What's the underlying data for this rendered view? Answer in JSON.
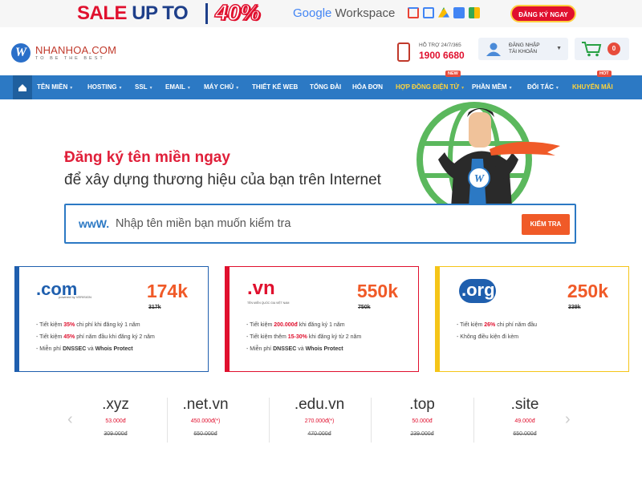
{
  "promo": {
    "sale": "SALE",
    "up_to": "UP TO",
    "percent": "40%",
    "google": "Google",
    "workspace": "Workspace",
    "cta": "ĐĂNG KÝ NGAY"
  },
  "header": {
    "logo_name": "NHANHOA.COM",
    "logo_tagline": "TO BE THE BEST",
    "support_label": "HỖ TRỢ 24/7/365",
    "support_phone": "1900 6680",
    "login_line1": "ĐĂNG NHẬP",
    "login_line2": "TÀI KHOẢN",
    "cart_count": "0"
  },
  "nav": {
    "items": [
      {
        "label": "TÊN MIỀN"
      },
      {
        "label": "HOSTING"
      },
      {
        "label": "SSL"
      },
      {
        "label": "EMAIL"
      },
      {
        "label": "MÁY CHỦ"
      },
      {
        "label": "THIẾT KẾ WEB"
      },
      {
        "label": "TỔNG ĐÀI"
      },
      {
        "label": "HÓA ĐƠN"
      },
      {
        "label": "HỢP ĐỒNG ĐIỆN TỬ",
        "badge": "NEW"
      },
      {
        "label": "PHẦN MỀM"
      },
      {
        "label": "ĐỐI TÁC"
      },
      {
        "label": "KHUYẾN MÃI",
        "badge": "HOT"
      }
    ]
  },
  "hero": {
    "title": "Đăng ký tên miền ngay",
    "subtitle": "để xây dựng thương hiệu của bạn trên Internet",
    "search_prefix": "wwW.",
    "search_placeholder": "Nhập tên miền bạn muốn kiểm tra",
    "search_button": "KIỂM TRA"
  },
  "cards": [
    {
      "ext": ".com",
      "logo_note": "powered by VERISIGN",
      "price": "174k",
      "old_price": "317k",
      "color": "#1f5fae",
      "features": [
        {
          "pre": "Tiết kiệm ",
          "hl": "35%",
          "post": " chi phí khi đăng ký 1 năm"
        },
        {
          "pre": "Tiết kiệm ",
          "hl": "45%",
          "post": " phí năm đầu khi đăng ký 2 năm"
        },
        {
          "pre": "Miễn phí ",
          "hl": "DNSSEC",
          "mid": " và ",
          "hl2": "Whois Protect",
          "post": ""
        }
      ]
    },
    {
      "ext": ".vn",
      "logo_note": "TÊN MIỀN QUỐC GIA VIỆT NAM",
      "price": "550k",
      "old_price": "750k",
      "color": "#e0102e",
      "features": [
        {
          "pre": "Tiết kiệm ",
          "hl": "200.000đ",
          "post": " khi đăng ký 1 năm"
        },
        {
          "pre": "Tiết kiệm thêm ",
          "hl": "15-30%",
          "post": " khi đăng ký từ 2 năm"
        },
        {
          "pre": "Miễn phí ",
          "hl": "DNSSEC",
          "mid": " và ",
          "hl2": "Whois Protect",
          "post": ""
        }
      ]
    },
    {
      "ext": ".org",
      "logo_note": "",
      "price": "250k",
      "old_price": "339k",
      "color": "#f5c518",
      "features": [
        {
          "pre": "Tiết kiệm ",
          "hl": "26%",
          "post": " chi phí năm đầu"
        },
        {
          "pre": "Không điều kiện đi kèm",
          "hl": "",
          "post": ""
        }
      ]
    }
  ],
  "extensions": [
    {
      "name": ".xyz",
      "price": "53.000đ",
      "old": "309.000đ"
    },
    {
      "name": ".net.vn",
      "price": "450.000đ(*)",
      "old": "650.000đ"
    },
    {
      "name": ".edu.vn",
      "price": "270.000đ(*)",
      "old": "470.000đ"
    },
    {
      "name": ".top",
      "price": "50.000đ",
      "old": "239.000đ"
    },
    {
      "name": ".site",
      "price": "49.000đ",
      "old": "650.000đ"
    }
  ]
}
